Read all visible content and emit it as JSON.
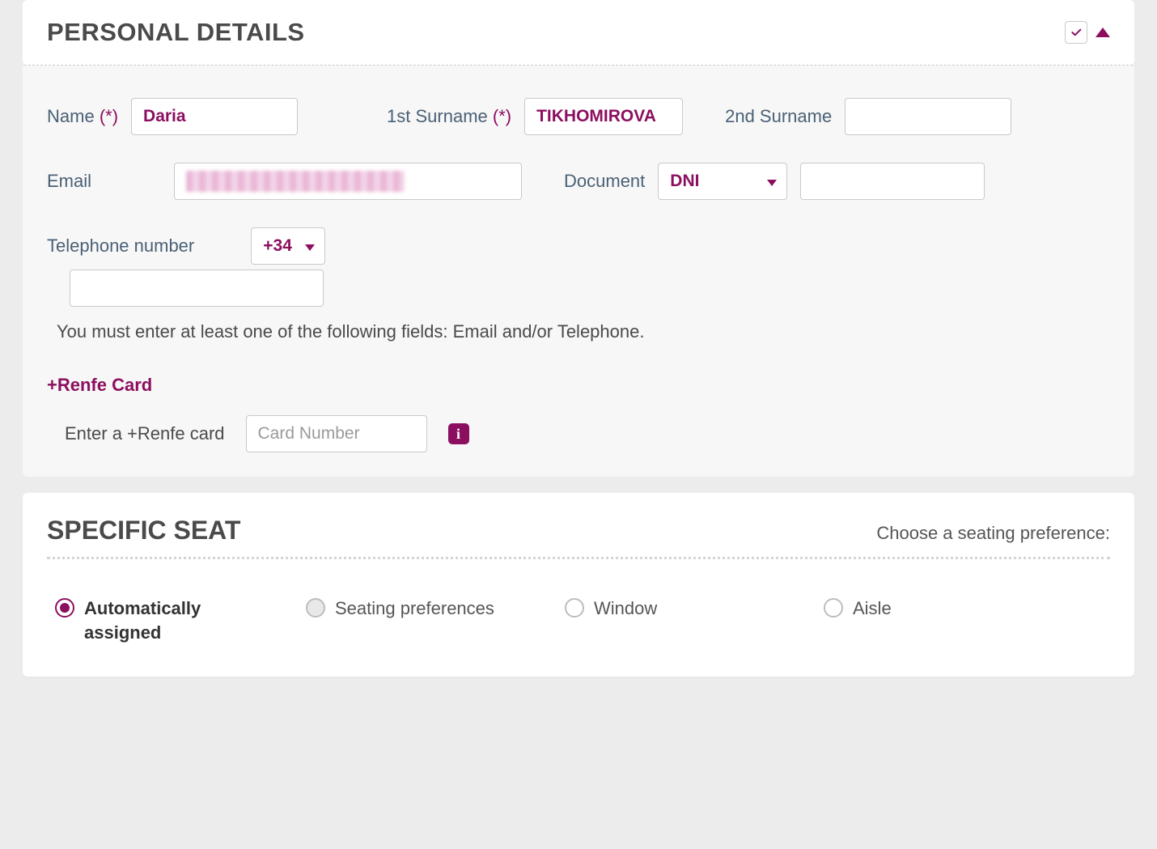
{
  "personal": {
    "title": "PERSONAL DETAILS",
    "labels": {
      "name": "Name",
      "surname1": "1st Surname",
      "surname2": "2nd Surname",
      "email": "Email",
      "document": "Document",
      "telephone": "Telephone number",
      "required_marker": "(*)"
    },
    "values": {
      "name": "Daria",
      "surname1": "TIKHOMIROVA",
      "surname2": "",
      "email": "",
      "document_type": "DNI",
      "document_number": "",
      "phone_prefix": "+34",
      "phone_number": ""
    },
    "hint": "You must enter at least one of the following fields: Email and/or Telephone."
  },
  "renfe_card": {
    "title": "+Renfe Card",
    "label": "Enter a +Renfe card",
    "placeholder": "Card Number",
    "value": "",
    "info_icon": "i"
  },
  "seat": {
    "title": "SPECIFIC SEAT",
    "subtitle": "Choose a seating preference:",
    "options": [
      {
        "label": "Automatically assigned",
        "selected": true,
        "state": "selected"
      },
      {
        "label": "Seating preferences",
        "selected": false,
        "state": "disabled"
      },
      {
        "label": "Window",
        "selected": false,
        "state": "normal"
      },
      {
        "label": "Aisle",
        "selected": false,
        "state": "normal"
      }
    ]
  }
}
